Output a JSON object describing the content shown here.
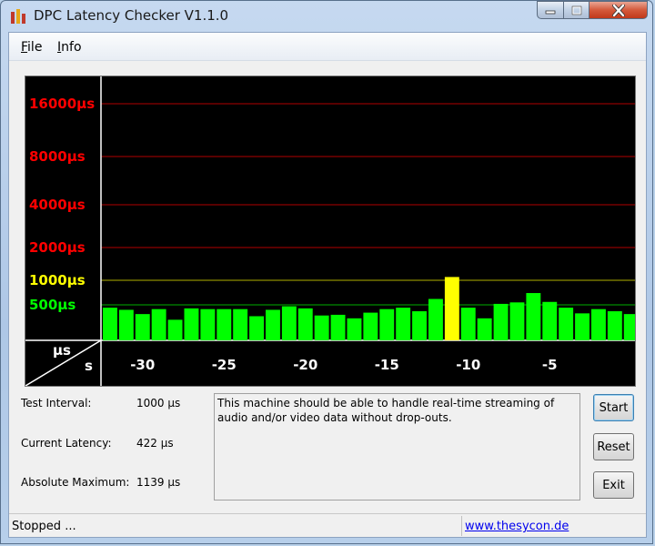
{
  "window": {
    "title": "DPC Latency Checker V1.1.0"
  },
  "menu": {
    "file": {
      "accel": "F",
      "rest": "ile"
    },
    "info": {
      "accel": "I",
      "rest": "nfo"
    }
  },
  "colors": {
    "ok": "#00ff00",
    "warn": "#ffff00",
    "critical": "#ff0000",
    "grid_red": "#b00000",
    "grid_yellow": "#b0b000",
    "grid_green": "#00b000"
  },
  "chart_data": {
    "type": "bar",
    "x_unit": "s",
    "y_unit": "µs",
    "x_ticks": [
      "-30",
      "-25",
      "-20",
      "-15",
      "-10",
      "-5"
    ],
    "x_tick_values": [
      -30,
      -25,
      -20,
      -15,
      -10,
      -5
    ],
    "y_ticks": [
      "16000µs",
      "8000µs",
      "4000µs",
      "2000µs",
      "1000µs",
      "500µs"
    ],
    "y_tick_values": [
      16000,
      8000,
      4000,
      2000,
      1000,
      500
    ],
    "x": [
      -32,
      -31,
      -30,
      -29,
      -28,
      -27,
      -26,
      -25,
      -24,
      -23,
      -22,
      -21,
      -20,
      -19,
      -18,
      -17,
      -16,
      -15,
      -14,
      -13,
      -12,
      -11,
      -10,
      -9,
      -8,
      -7,
      -6,
      -5,
      -4,
      -3,
      -2,
      -1
    ],
    "values": [
      460,
      430,
      370,
      440,
      290,
      450,
      440,
      440,
      440,
      340,
      430,
      480,
      450,
      350,
      360,
      310,
      390,
      440,
      460,
      410,
      620,
      1100,
      460,
      310,
      520,
      550,
      740,
      560,
      460,
      380,
      440,
      410,
      370
    ],
    "highlight_index": 21
  },
  "info": {
    "test_interval_label": "Test Interval:",
    "test_interval_value": "1000 µs",
    "current_latency_label": "Current Latency:",
    "current_latency_value": "422 µs",
    "absolute_maximum_label": "Absolute Maximum:",
    "absolute_maximum_value": "1139 µs"
  },
  "message": "This machine should be able to handle real-time streaming of audio and/or video data without drop-outs.",
  "buttons": {
    "start": "Start",
    "reset": "Reset",
    "exit": "Exit"
  },
  "status": {
    "text": "Stopped ...",
    "link": "www.thesycon.de"
  },
  "icons": {
    "app": "bars-chart-icon",
    "minimize": "minimize-icon",
    "maximize": "maximize-icon",
    "close": "close-icon"
  }
}
